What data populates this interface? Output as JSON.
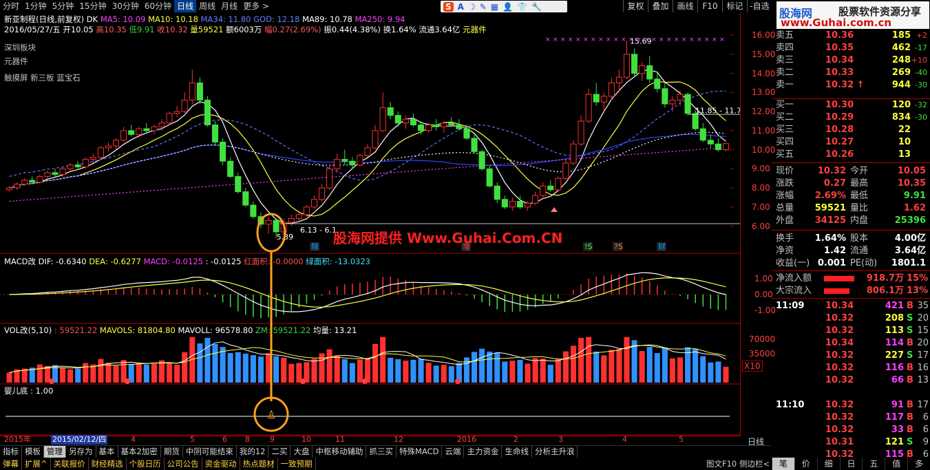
{
  "period_tabs": [
    "分时",
    "1分钟",
    "5分钟",
    "15分钟",
    "30分钟",
    "60分钟",
    "日线",
    "周线",
    "月线",
    "更多 >"
  ],
  "period_active": 6,
  "right_menu": [
    "复权",
    "叠加",
    "画线",
    "F10",
    "标记",
    "-自选"
  ],
  "toolbar_icons": [
    "S",
    "A",
    "☽",
    "✎",
    "▦",
    "👤",
    "👕",
    "🔧"
  ],
  "brand": {
    "site": "股海网",
    "slogan": "股票软件资源分享",
    "url": "www.Guhai.com.cn"
  },
  "chart_header": {
    "title": "新亚制程(日线,前复权) DK",
    "ma5": "MA5: 10.09",
    "ma10": "MA10: 10.18",
    "ma34": "MA34: 11.80",
    "god": "GOD: 12.18",
    "ma89": "MA89: 10.78",
    "ma250": "MA250: 9.94",
    "line2_date": "2016/05/27/五",
    "line2_open": "开10.05",
    "line2_high": "高10.35",
    "line2_low": "低9.91",
    "line2_close": "收10.32",
    "line2_vol": "量59521",
    "line2_amt": "额6003万",
    "line2_chg": "幅0.27(2.69%)",
    "line2_amp": "振0.44(4.38%)",
    "line2_turn": "换1.64%",
    "line2_float": "流通3.64亿",
    "line2_concept": "元器件",
    "tags": [
      "深圳板块",
      "元器件",
      "触摸屏 新三板 蓝宝石"
    ]
  },
  "watermark": "股海网提供 Www.Guhai.Com.CN",
  "annotations": {
    "hi": "15.69",
    "lo": "5.39",
    "range1": "6.13 - 6.1",
    "range2": "11.85 - 11.75"
  },
  "event_marks": [
    "除",
    "增",
    "!S",
    "?S",
    "财"
  ],
  "macd_header": {
    "label": "MACD改",
    "dif": "DIF: -0.6340",
    "dea": "DEA: -0.6277",
    "macd": "MACD: -0.0125",
    "v": ": -0.0125",
    "red": "红面积: -0.0000",
    "green": "绿面积: -13.0323"
  },
  "vol_header": {
    "label": "VOL改(5,10)",
    "v": ": 59521.22",
    "mavols": "MAVOLS: 81804.80",
    "mavoll": "MAVOLL: 96578.80",
    "zm": "ZM: 59521.22",
    "avg": "均量: 13.21"
  },
  "baby_header": {
    "label": "婴儿底 : 1.00"
  },
  "price_axis": [
    "16.00",
    "15.00",
    "14.00",
    "13.00",
    "12.00",
    "11.00",
    "10.00",
    "9.00",
    "8.00",
    "7.00",
    "6.00"
  ],
  "macd_axis": [
    "1.00",
    "0.00",
    "-1.00"
  ],
  "vol_axis": [
    "70000",
    "35000",
    "X10"
  ],
  "date_axis": [
    {
      "t": "2015年",
      "cls": ""
    },
    {
      "t": "2015/02/12/四",
      "cls": "cur"
    },
    {
      "t": "4",
      "cls": ""
    },
    {
      "t": "5",
      "cls": ""
    },
    {
      "t": "6",
      "cls": ""
    },
    {
      "t": "8",
      "cls": ""
    },
    {
      "t": "9",
      "cls": ""
    },
    {
      "t": "10",
      "cls": ""
    },
    {
      "t": "11",
      "cls": ""
    },
    {
      "t": "12",
      "cls": ""
    },
    {
      "t": "2016",
      "cls": ""
    },
    {
      "t": "2",
      "cls": ""
    },
    {
      "t": "3",
      "cls": ""
    },
    {
      "t": "4",
      "cls": ""
    },
    {
      "t": "5",
      "cls": ""
    }
  ],
  "axis_corner": "日线",
  "bottom_tabs": [
    "指标",
    "模板",
    "管理",
    "另存为",
    "基本",
    "基本2加密",
    "期货",
    "中阴可能结束",
    "我的12",
    "二买",
    "大盘",
    "中枢移动辅助",
    "抓三买",
    "特殊MACD",
    "云端",
    "主力资金",
    "生命线",
    "分析主升浪"
  ],
  "bottom_tab_active": 2,
  "func_tabs": [
    "弹幕",
    "扩展^",
    "关联报价",
    "财经精选",
    "个股日历",
    "公司公告",
    "资金驱动",
    "热点题材",
    "一致预期"
  ],
  "func_right": [
    "图文F10",
    "侧边栏<"
  ],
  "right_bottom_tabs": [
    "笔",
    "价",
    "细",
    "日",
    "五",
    "值",
    "多"
  ],
  "quote": {
    "asks": [
      {
        "label": "卖五",
        "price": "10.36",
        "vol": "185",
        "chg": "+2"
      },
      {
        "label": "卖四",
        "price": "10.35",
        "vol": "462",
        "chg": "-17"
      },
      {
        "label": "卖三",
        "price": "10.34",
        "vol": "248",
        "chg": "+10"
      },
      {
        "label": "卖二",
        "price": "10.33",
        "vol": "269",
        "chg": "-40"
      },
      {
        "label": "卖一",
        "price": "10.32 ↑",
        "vol": "944",
        "chg": "-30"
      }
    ],
    "bids": [
      {
        "label": "买一",
        "price": "10.30",
        "vol": "120",
        "chg": "-32"
      },
      {
        "label": "买二",
        "price": "10.29",
        "vol": "834",
        "chg": "-30"
      },
      {
        "label": "买三",
        "price": "10.28",
        "vol": "22",
        "chg": ""
      },
      {
        "label": "买四",
        "price": "10.27",
        "vol": "10",
        "chg": ""
      },
      {
        "label": "买五",
        "price": "10.26",
        "vol": "13",
        "chg": ""
      }
    ],
    "stats": [
      {
        "l1": "现价",
        "v1": "10.32",
        "l2": "今开",
        "v2": "10.05"
      },
      {
        "l1": "涨跌",
        "v1": "0.27",
        "l2": "最高",
        "v2": "10.35"
      },
      {
        "l1": "涨幅",
        "v1": "2.69%",
        "l2": "最低",
        "v2": "9.91"
      },
      {
        "l1": "总量",
        "v1": "59521",
        "l2": "量比",
        "v2": "1.62"
      },
      {
        "l1": "外盘",
        "v1": "34125",
        "l2": "内盘",
        "v2": "25396"
      }
    ],
    "stats2": [
      {
        "l1": "换手",
        "v1": "1.64%",
        "l2": "股本",
        "v2": "4.00亿"
      },
      {
        "l1": "净资",
        "v1": "1.42",
        "l2": "流通",
        "v2": "3.64亿"
      },
      {
        "l1": "收益(一)",
        "v1": "0.001",
        "l2": "PE(动)",
        "v2": "1801.1"
      }
    ],
    "flows": [
      {
        "label": "净流入额",
        "val": "918.7万",
        "pct": "15%",
        "bar": 0.95
      },
      {
        "label": "大宗流入",
        "val": "806.1万",
        "pct": "13%",
        "bar": 0.8
      }
    ],
    "ticks": [
      {
        "time": "11:09",
        "price": "10.34",
        "vol": "421",
        "bs": "B",
        "n": "35"
      },
      {
        "time": "",
        "price": "10.32",
        "vol": "208",
        "bs": "S",
        "n": "20"
      },
      {
        "time": "",
        "price": "10.32",
        "vol": "113",
        "bs": "S",
        "n": "15"
      },
      {
        "time": "",
        "price": "10.34",
        "vol": "114",
        "bs": "B",
        "n": "20"
      },
      {
        "time": "",
        "price": "10.32",
        "vol": "227",
        "bs": "S",
        "n": "17"
      },
      {
        "time": "",
        "price": "10.32",
        "vol": "116",
        "bs": "B",
        "n": "16"
      },
      {
        "time": "",
        "price": "10.32",
        "vol": "66",
        "bs": "B",
        "n": "13"
      },
      {
        "time": "11:10",
        "price": "10.32",
        "vol": "91",
        "bs": "B",
        "n": "17"
      },
      {
        "time": "",
        "price": "10.32",
        "vol": "117",
        "bs": "B",
        "n": "6"
      },
      {
        "time": "",
        "price": "10.32",
        "vol": "33",
        "bs": "B",
        "n": "6"
      },
      {
        "time": "",
        "price": "10.31",
        "vol": "121",
        "bs": "S",
        "n": "9"
      },
      {
        "time": "",
        "price": "10.32",
        "vol": "115",
        "bs": "B",
        "n": "6"
      }
    ]
  },
  "chart_data": {
    "type": "candlestick",
    "price_range": [
      5.3,
      16.4
    ],
    "candles": [
      [
        7.9,
        8.1,
        7.8,
        8.0
      ],
      [
        8.0,
        8.3,
        7.9,
        8.2
      ],
      [
        8.2,
        8.5,
        8.1,
        8.4
      ],
      [
        8.4,
        8.6,
        8.2,
        8.3
      ],
      [
        8.3,
        8.7,
        8.2,
        8.6
      ],
      [
        8.6,
        8.9,
        8.5,
        8.8
      ],
      [
        8.8,
        9.0,
        8.6,
        8.7
      ],
      [
        8.7,
        9.1,
        8.6,
        9.0
      ],
      [
        9.0,
        9.3,
        8.9,
        9.2
      ],
      [
        9.2,
        9.4,
        9.0,
        9.1
      ],
      [
        9.1,
        9.6,
        9.0,
        9.5
      ],
      [
        9.5,
        9.8,
        9.3,
        9.6
      ],
      [
        9.6,
        10.2,
        9.5,
        10.1
      ],
      [
        10.1,
        10.4,
        9.9,
        10.2
      ],
      [
        10.2,
        10.6,
        10.0,
        10.5
      ],
      [
        10.5,
        11.2,
        10.4,
        11.0
      ],
      [
        11.0,
        11.3,
        10.7,
        10.8
      ],
      [
        10.8,
        11.2,
        10.6,
        11.1
      ],
      [
        11.1,
        11.4,
        10.9,
        11.0
      ],
      [
        11.0,
        11.3,
        10.8,
        11.2
      ],
      [
        11.2,
        11.6,
        11.0,
        11.4
      ],
      [
        11.4,
        12.0,
        11.3,
        11.9
      ],
      [
        11.9,
        12.3,
        11.7,
        12.0
      ],
      [
        12.0,
        13.0,
        11.9,
        12.6
      ],
      [
        12.6,
        14.2,
        12.4,
        13.5
      ],
      [
        13.5,
        13.8,
        12.4,
        12.6
      ],
      [
        12.6,
        12.8,
        11.2,
        11.3
      ],
      [
        11.3,
        11.5,
        10.2,
        10.4
      ],
      [
        10.4,
        10.6,
        9.2,
        9.4
      ],
      [
        9.4,
        9.6,
        8.5,
        8.6
      ],
      [
        8.6,
        8.8,
        7.7,
        7.8
      ],
      [
        7.8,
        8.0,
        7.0,
        7.1
      ],
      [
        7.1,
        7.3,
        6.4,
        6.5
      ],
      [
        6.5,
        6.7,
        5.9,
        6.1
      ],
      [
        6.1,
        6.5,
        5.6,
        6.3
      ],
      [
        6.3,
        6.4,
        5.4,
        5.7
      ],
      [
        5.7,
        6.4,
        5.5,
        6.2
      ],
      [
        6.2,
        6.6,
        6.0,
        6.4
      ],
      [
        6.4,
        6.8,
        6.2,
        6.6
      ],
      [
        6.6,
        7.1,
        6.5,
        7.0
      ],
      [
        7.0,
        7.6,
        6.9,
        7.4
      ],
      [
        7.4,
        8.2,
        7.3,
        8.0
      ],
      [
        8.0,
        9.2,
        7.9,
        9.0
      ],
      [
        9.0,
        9.8,
        8.8,
        9.5
      ],
      [
        9.5,
        10.0,
        9.2,
        9.4
      ],
      [
        9.4,
        9.6,
        9.0,
        9.2
      ],
      [
        9.2,
        9.8,
        9.1,
        9.7
      ],
      [
        9.7,
        10.3,
        9.6,
        10.1
      ],
      [
        10.1,
        11.3,
        10.0,
        11.0
      ],
      [
        11.0,
        13.0,
        10.9,
        12.2
      ],
      [
        12.2,
        12.5,
        11.6,
        11.8
      ],
      [
        11.8,
        12.0,
        11.2,
        11.4
      ],
      [
        11.4,
        11.8,
        11.1,
        11.6
      ],
      [
        11.6,
        11.9,
        11.2,
        11.3
      ],
      [
        11.3,
        11.5,
        10.8,
        11.0
      ],
      [
        11.0,
        11.4,
        10.9,
        11.3
      ],
      [
        11.3,
        11.6,
        11.0,
        11.2
      ],
      [
        11.2,
        11.5,
        10.9,
        11.4
      ],
      [
        11.4,
        11.7,
        11.2,
        11.3
      ],
      [
        11.3,
        11.6,
        11.0,
        11.1
      ],
      [
        11.1,
        11.3,
        10.5,
        10.6
      ],
      [
        10.6,
        10.8,
        9.8,
        9.9
      ],
      [
        9.9,
        10.0,
        8.9,
        9.0
      ],
      [
        9.0,
        9.2,
        8.0,
        8.1
      ],
      [
        8.1,
        8.3,
        7.2,
        7.4
      ],
      [
        7.4,
        7.6,
        6.9,
        7.0
      ],
      [
        7.0,
        7.5,
        6.8,
        7.3
      ],
      [
        7.3,
        7.6,
        6.9,
        7.0
      ],
      [
        7.0,
        7.3,
        6.8,
        7.2
      ],
      [
        7.2,
        7.8,
        7.1,
        7.6
      ],
      [
        7.6,
        8.3,
        7.4,
        8.1
      ],
      [
        8.1,
        8.4,
        7.8,
        7.9
      ],
      [
        7.9,
        8.6,
        7.8,
        8.5
      ],
      [
        8.5,
        9.5,
        8.4,
        9.3
      ],
      [
        9.3,
        10.5,
        9.2,
        10.3
      ],
      [
        10.3,
        11.8,
        10.2,
        11.5
      ],
      [
        11.5,
        13.2,
        11.4,
        12.9
      ],
      [
        12.9,
        13.5,
        12.3,
        12.5
      ],
      [
        12.5,
        13.0,
        12.0,
        12.8
      ],
      [
        12.8,
        13.8,
        12.6,
        13.5
      ],
      [
        13.5,
        14.2,
        13.0,
        13.8
      ],
      [
        13.8,
        15.7,
        13.7,
        15.0
      ],
      [
        15.0,
        15.3,
        13.8,
        14.0
      ],
      [
        14.0,
        14.6,
        13.6,
        14.4
      ],
      [
        14.4,
        14.9,
        13.5,
        13.7
      ],
      [
        13.7,
        14.1,
        13.0,
        13.2
      ],
      [
        13.2,
        13.5,
        12.2,
        12.4
      ],
      [
        12.4,
        12.8,
        12.0,
        12.6
      ],
      [
        12.6,
        13.1,
        12.3,
        12.9
      ],
      [
        12.9,
        13.0,
        11.8,
        11.9
      ],
      [
        11.9,
        12.1,
        11.0,
        11.1
      ],
      [
        11.1,
        11.4,
        10.4,
        10.5
      ],
      [
        10.5,
        10.8,
        10.1,
        10.3
      ],
      [
        10.3,
        10.6,
        9.9,
        10.0
      ],
      [
        10.0,
        10.35,
        9.91,
        10.32
      ]
    ],
    "macd_range": [
      -1.6,
      1.6
    ],
    "vol_max": 80000,
    "series_names": [
      "MA5",
      "MA10",
      "MA34",
      "GOD",
      "MA89",
      "MA250"
    ]
  }
}
